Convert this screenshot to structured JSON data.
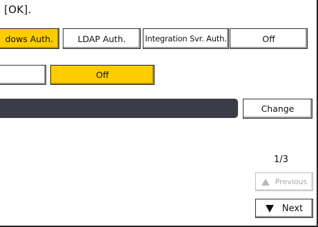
{
  "instruction": "[OK].",
  "auth_options": {
    "windows": "dows Auth.",
    "ldap": "LDAP Auth.",
    "integration": "Integration Svr. Auth.",
    "off": "Off"
  },
  "row2": {
    "blank": "",
    "off": "Off"
  },
  "change_label": "Change",
  "pagination": {
    "indicator": "1/3",
    "previous": "Previous",
    "next": "Next"
  },
  "colors": {
    "selected": "#ffcc00",
    "bar": "#3b3c47"
  }
}
